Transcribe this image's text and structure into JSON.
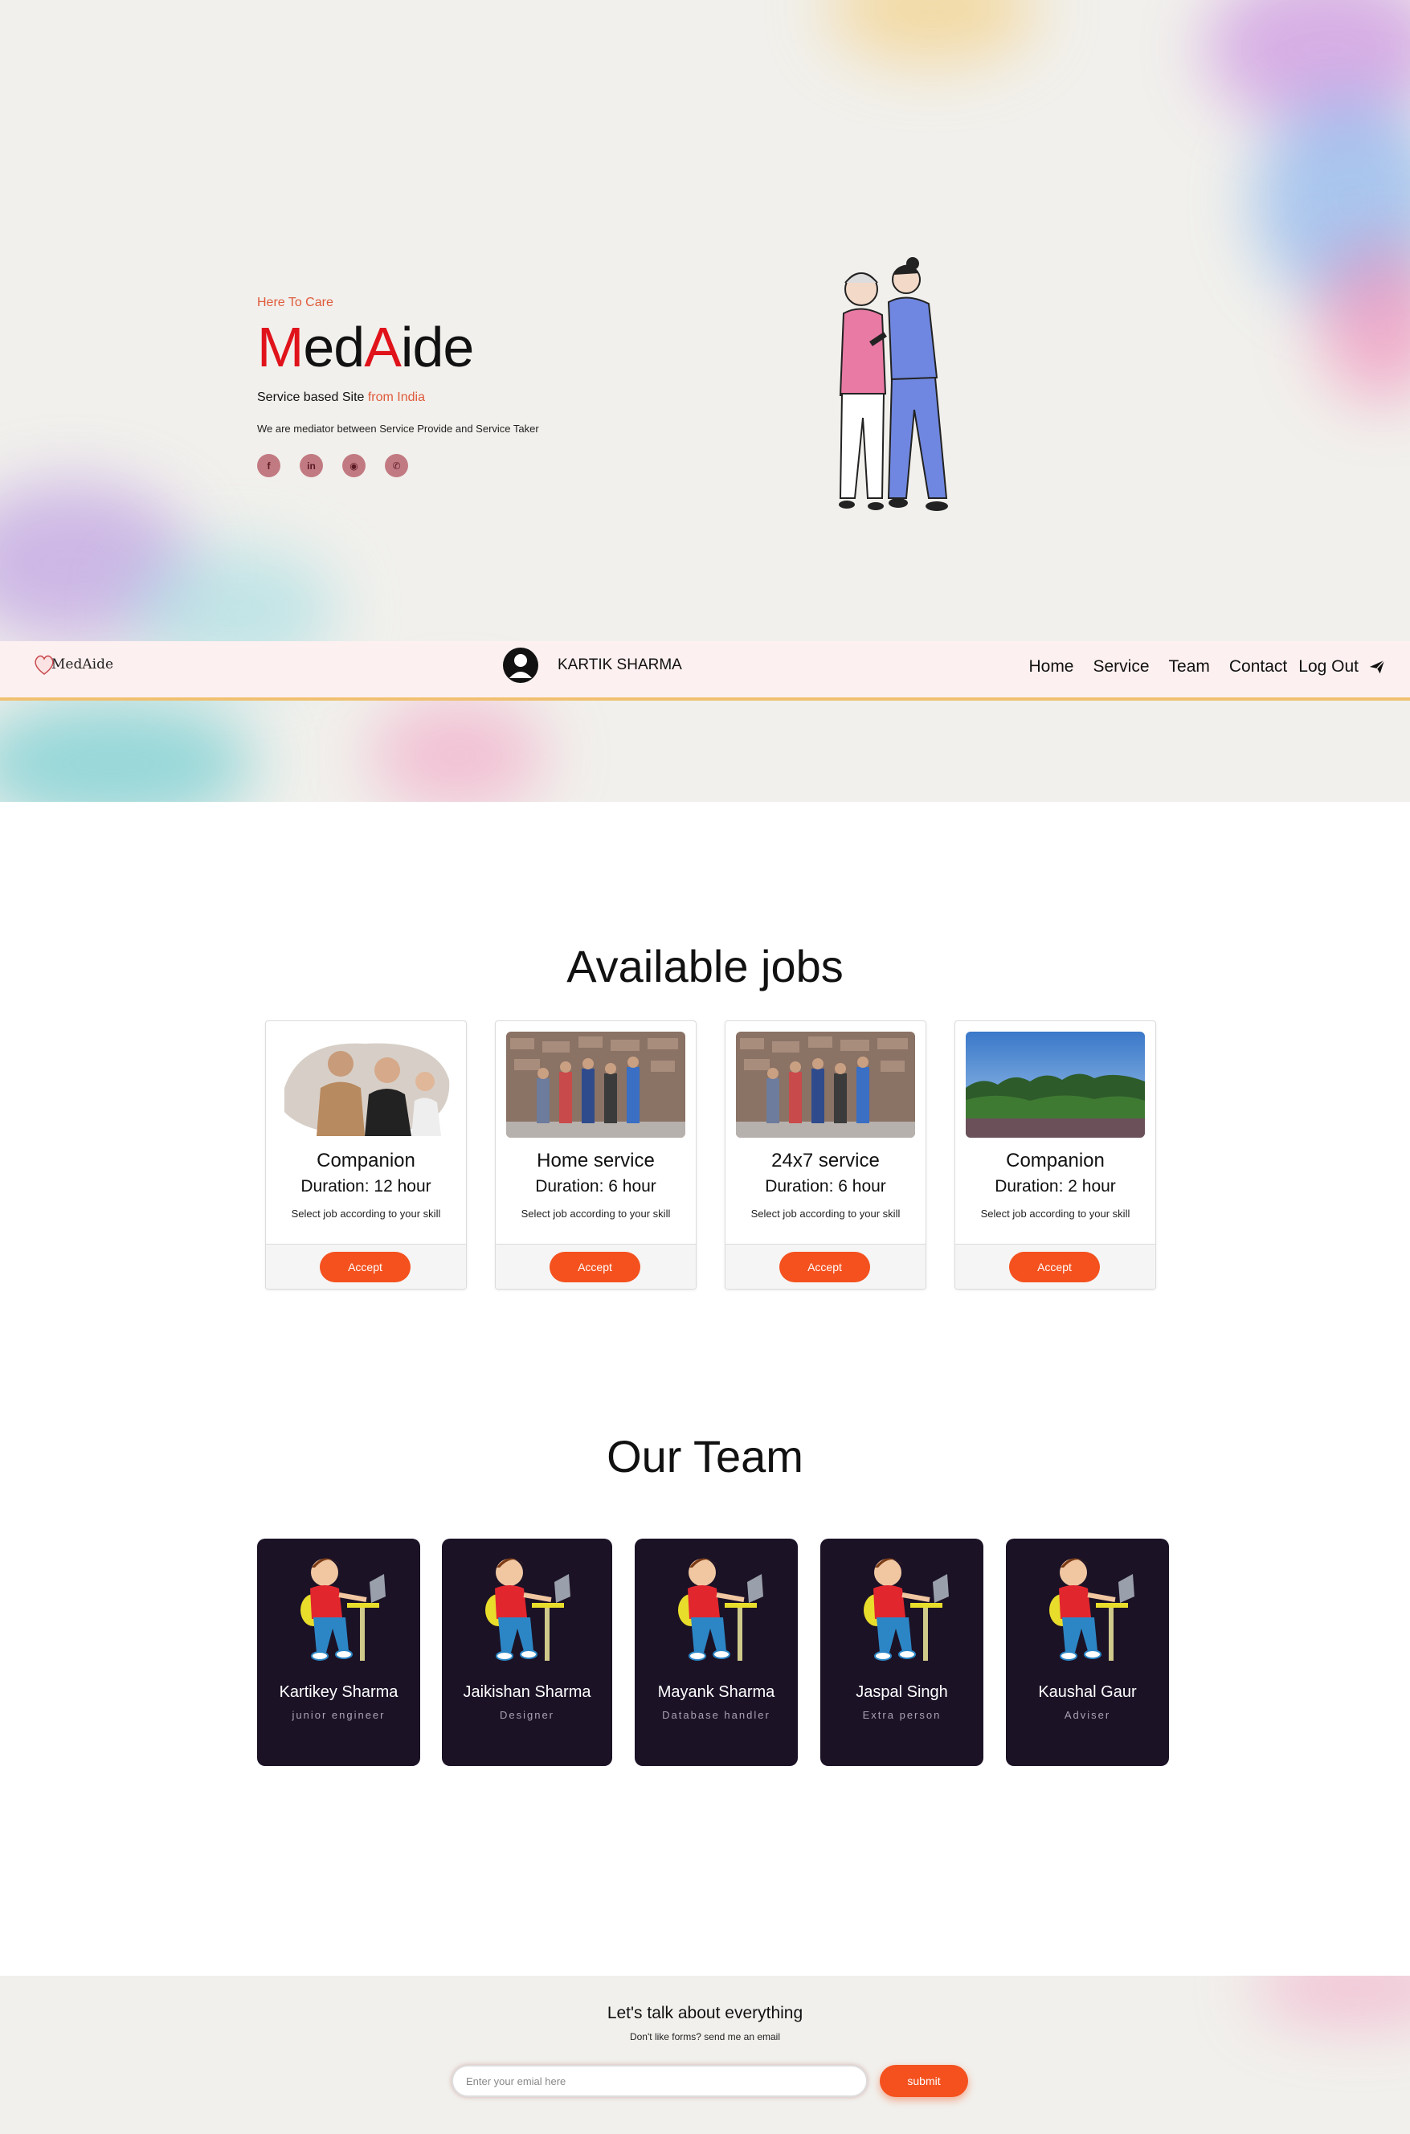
{
  "hero": {
    "tagline": "Here To Care",
    "brand_part1": "M",
    "brand_part2": "ed",
    "brand_part3": "A",
    "brand_part4": "ide",
    "subline_main": "Service based Site ",
    "subline_accent": "from India",
    "description": "We are mediator between Service Provide and Service Taker",
    "socials": [
      {
        "icon": "facebook-icon",
        "glyph": "f"
      },
      {
        "icon": "linkedin-icon",
        "glyph": "in"
      },
      {
        "icon": "github-icon",
        "glyph": "◉"
      },
      {
        "icon": "whatsapp-icon",
        "glyph": "✆"
      }
    ]
  },
  "navbar": {
    "logo_text": "MedAide",
    "user_name": "KARTIK SHARMA",
    "links": [
      "Home",
      "Service",
      "Team",
      "Contact"
    ],
    "logout_label": "Log Out"
  },
  "jobs": {
    "title": "Available jobs",
    "items": [
      {
        "title": "Companion",
        "duration": "Duration: 12 hour",
        "note": "Select job according to your skill",
        "button": "Accept"
      },
      {
        "title": "Home service",
        "duration": "Duration: 6 hour",
        "note": "Select job according to your skill",
        "button": "Accept"
      },
      {
        "title": "24x7 service",
        "duration": "Duration: 6 hour",
        "note": "Select job according to your skill",
        "button": "Accept"
      },
      {
        "title": "Companion",
        "duration": "Duration: 2 hour",
        "note": "Select job according to your skill",
        "button": "Accept"
      }
    ]
  },
  "team": {
    "title": "Our Team",
    "members": [
      {
        "name": "Kartikey Sharma",
        "role": "junior engineer"
      },
      {
        "name": "Jaikishan Sharma",
        "role": "Designer"
      },
      {
        "name": "Mayank Sharma",
        "role": "Database handler"
      },
      {
        "name": "Jaspal Singh",
        "role": "Extra person"
      },
      {
        "name": "Kaushal Gaur",
        "role": "Adviser"
      }
    ]
  },
  "footer": {
    "title": "Let's talk about everything",
    "subtitle": "Don't like forms? send me an email",
    "email_placeholder": "Enter your emial here",
    "submit_label": "submit"
  },
  "colors": {
    "accent": "#f4511e",
    "brand_red": "#e0131b",
    "team_card": "#1b1226",
    "navbar_bg": "#fdf0f0"
  }
}
